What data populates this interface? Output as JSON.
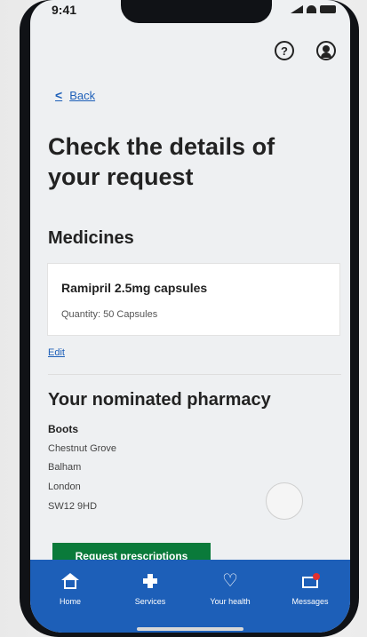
{
  "status_bar": {
    "time": "9:41"
  },
  "header": {
    "help_icon": "?"
  },
  "nav": {
    "back_label": "Back",
    "back_chevron": "<"
  },
  "page": {
    "title": "Check the details of your request"
  },
  "medicines": {
    "heading": "Medicines",
    "item": {
      "name": "Ramipril 2.5mg capsules",
      "quantity": "Quantity: 50 Capsules"
    },
    "edit_label": "Edit"
  },
  "pharmacy": {
    "heading": "Your nominated pharmacy",
    "name": "Boots",
    "address": [
      "Chestnut Grove",
      "Balham",
      "London",
      "SW12 9HD"
    ]
  },
  "actions": {
    "request_label": "Request prescriptions"
  },
  "tab_bar": {
    "tabs": [
      {
        "label": "Home",
        "icon": "home-icon"
      },
      {
        "label": "Services",
        "icon": "cross-icon"
      },
      {
        "label": "Your health",
        "icon": "heart-icon"
      },
      {
        "label": "Messages",
        "icon": "message-icon"
      }
    ]
  },
  "colors": {
    "nhs_blue": "#1d5fb8",
    "button_green": "#0a7a3a",
    "link_blue": "#1d5fb8"
  }
}
